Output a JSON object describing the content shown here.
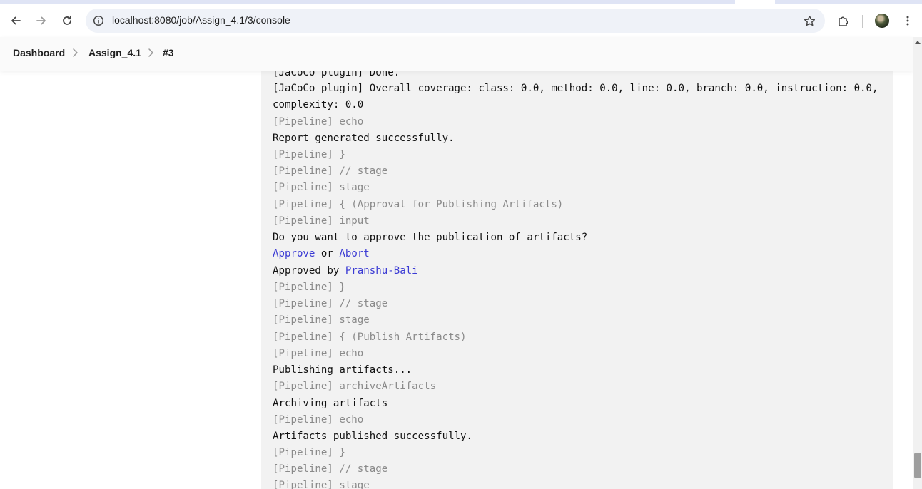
{
  "browser": {
    "url": "localhost:8080/job/Assign_4.1/3/console",
    "icons": {
      "back": "arrow-left-icon",
      "forward": "arrow-right-icon",
      "reload": "reload-icon",
      "site_info": "info-icon",
      "bookmark": "star-icon",
      "extensions": "puzzle-icon",
      "menu": "kebab-menu-icon"
    }
  },
  "breadcrumb": {
    "items": [
      "Dashboard",
      "Assign_4.1",
      "#3"
    ]
  },
  "console": {
    "lines": [
      {
        "text": "[JaCoCo plugin] Done.",
        "style": "normal"
      },
      {
        "text": "[JaCoCo plugin] Overall coverage: class: 0.0, method: 0.0, line: 0.0, branch: 0.0, instruction: 0.0,",
        "style": "normal"
      },
      {
        "text": "complexity: 0.0",
        "style": "normal"
      },
      {
        "text": "[Pipeline] echo",
        "style": "dim"
      },
      {
        "text": "Report generated successfully.",
        "style": "normal"
      },
      {
        "text": "[Pipeline] }",
        "style": "dim"
      },
      {
        "text": "[Pipeline] // stage",
        "style": "dim"
      },
      {
        "text": "[Pipeline] stage",
        "style": "dim"
      },
      {
        "text": "[Pipeline] { (Approval for Publishing Artifacts)",
        "style": "dim"
      },
      {
        "text": "[Pipeline] input",
        "style": "dim"
      },
      {
        "text": "Do you want to approve the publication of artifacts?",
        "style": "normal"
      },
      {
        "text": "",
        "style": "approve"
      },
      {
        "text": "",
        "style": "approved"
      },
      {
        "text": "[Pipeline] }",
        "style": "dim"
      },
      {
        "text": "[Pipeline] // stage",
        "style": "dim"
      },
      {
        "text": "[Pipeline] stage",
        "style": "dim"
      },
      {
        "text": "[Pipeline] { (Publish Artifacts)",
        "style": "dim"
      },
      {
        "text": "[Pipeline] echo",
        "style": "dim"
      },
      {
        "text": "Publishing artifacts...",
        "style": "normal"
      },
      {
        "text": "[Pipeline] archiveArtifacts",
        "style": "dim"
      },
      {
        "text": "Archiving artifacts",
        "style": "normal"
      },
      {
        "text": "[Pipeline] echo",
        "style": "dim"
      },
      {
        "text": "Artifacts published successfully.",
        "style": "normal"
      },
      {
        "text": "[Pipeline] }",
        "style": "dim"
      },
      {
        "text": "[Pipeline] // stage",
        "style": "dim"
      },
      {
        "text": "[Pipeline] stage",
        "style": "dim"
      }
    ],
    "approve_prompt": {
      "approve_label": "Approve",
      "or_text": " or ",
      "abort_label": "Abort"
    },
    "approved_by": {
      "prefix": "Approved by ",
      "user": "Pranshu-Bali"
    }
  },
  "colors": {
    "link": "#3b3bd4",
    "dim_text": "#8a8a8a",
    "console_bg": "#f2f2f2"
  }
}
